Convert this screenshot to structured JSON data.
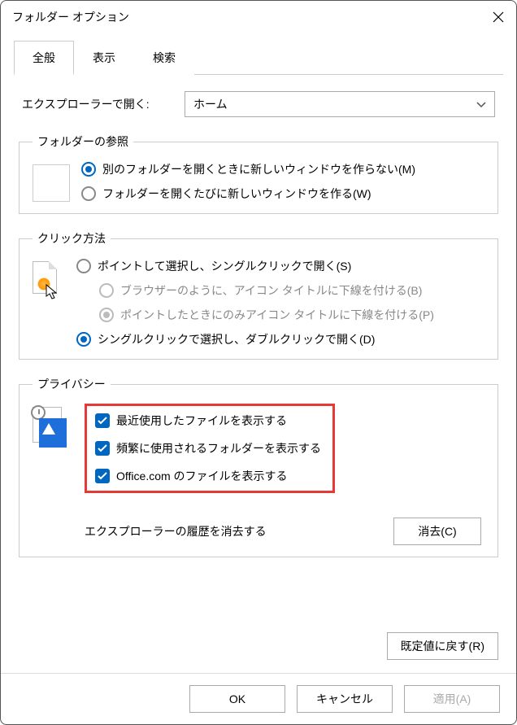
{
  "window": {
    "title": "フォルダー オプション"
  },
  "tabs": {
    "general": "全般",
    "view": "表示",
    "search": "検索"
  },
  "open_with": {
    "label": "エクスプローラーで開く:",
    "value": "ホーム"
  },
  "browse": {
    "legend": "フォルダーの参照",
    "opt_same": "別のフォルダーを開くときに新しいウィンドウを作らない(M)",
    "opt_new": "フォルダーを開くたびに新しいウィンドウを作る(W)"
  },
  "click": {
    "legend": "クリック方法",
    "single": "ポイントして選択し、シングルクリックで開く(S)",
    "sub_browser": "ブラウザーのように、アイコン タイトルに下線を付ける(B)",
    "sub_point": "ポイントしたときにのみアイコン タイトルに下線を付ける(P)",
    "double": "シングルクリックで選択し、ダブルクリックで開く(D)"
  },
  "privacy": {
    "legend": "プライバシー",
    "recent": "最近使用したファイルを表示する",
    "frequent": "頻繁に使用されるフォルダーを表示する",
    "office": "Office.com のファイルを表示する",
    "clear_label": "エクスプローラーの履歴を消去する",
    "clear_btn": "消去(C)"
  },
  "restore_btn": "既定値に戻す(R)",
  "footer": {
    "ok": "OK",
    "cancel": "キャンセル",
    "apply": "適用(A)"
  }
}
